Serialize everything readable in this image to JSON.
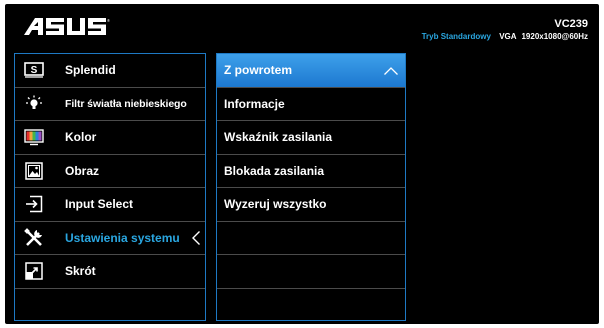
{
  "header": {
    "brand": "ASUS",
    "model": "VC239",
    "mode": "Tryb Standardowy",
    "input": "VGA",
    "resolution": "1920x1080@60Hz",
    "accent_color": "#2aa6e0",
    "border_color": "#1e79c4"
  },
  "main_menu": {
    "items": [
      {
        "label": "Splendid",
        "icon": "splendid-s-icon"
      },
      {
        "label": "Filtr światła niebieskiego",
        "icon": "bulb-icon"
      },
      {
        "label": "Kolor",
        "icon": "color-monitor-icon"
      },
      {
        "label": "Obraz",
        "icon": "image-icon"
      },
      {
        "label": "Input Select",
        "icon": "input-arrow-icon"
      },
      {
        "label": "Ustawienia systemu",
        "icon": "tools-icon",
        "selected": true
      },
      {
        "label": "Skrót",
        "icon": "shortcut-icon"
      },
      {
        "label": ""
      }
    ]
  },
  "submenu": {
    "items": [
      {
        "label": "Z powrotem",
        "highlighted": true
      },
      {
        "label": "Informacje"
      },
      {
        "label": "Wskaźnik zasilania"
      },
      {
        "label": "Blokada zasilania"
      },
      {
        "label": "Wyzeruj wszystko"
      },
      {
        "label": ""
      },
      {
        "label": ""
      },
      {
        "label": ""
      }
    ]
  }
}
